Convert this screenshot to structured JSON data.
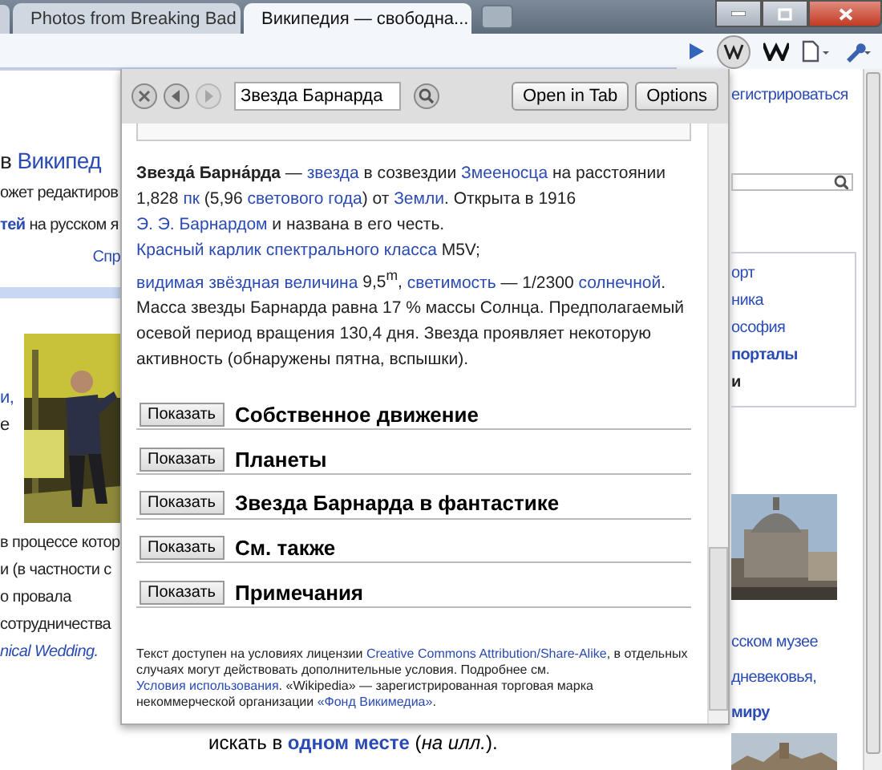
{
  "browser": {
    "tabs": [
      {
        "label": "Photos from Breaking Bad",
        "selected": false
      },
      {
        "label": "Википедия — свободна...",
        "selected": true
      }
    ]
  },
  "background": {
    "left": [
      [
        {
          "text": "в ",
          "kind": "heading"
        },
        {
          "text": "Википед",
          "kind": "heading-link"
        }
      ],
      [
        {
          "text": "ожет редактиров",
          "kind": "plain"
        }
      ],
      [
        {
          "text": "тей",
          "kind": "bold-link"
        },
        {
          "text": " на русском я",
          "kind": "plain"
        }
      ],
      [
        {
          "text": "Спр",
          "kind": "link"
        }
      ],
      [
        {
          "text": "и,",
          "kind": "link"
        }
      ],
      [
        {
          "text": "е",
          "kind": "plain"
        }
      ],
      [
        {
          "text": "в процессе котор",
          "kind": "plain"
        }
      ],
      [
        {
          "text": "и (в частности с",
          "kind": "plain"
        }
      ],
      [
        {
          "text": "о провала",
          "kind": "plain"
        }
      ],
      [
        {
          "text": "сотрудничества",
          "kind": "plain"
        }
      ],
      [
        {
          "text": "nical Wedding.",
          "kind": "italic-link"
        }
      ]
    ],
    "right": [
      [
        {
          "text": "егистрироваться",
          "kind": "link"
        }
      ],
      [
        {
          "text": "орт",
          "kind": "link"
        }
      ],
      [
        {
          "text": "ника",
          "kind": "link"
        }
      ],
      [
        {
          "text": "ософия",
          "kind": "link"
        }
      ],
      [
        {
          "text": "порталы",
          "kind": "bold-link"
        }
      ],
      [
        {
          "text": "и",
          "kind": "bold"
        }
      ],
      [
        {
          "text": "сском музее",
          "kind": "link"
        }
      ],
      [
        {
          "text": "дневековья,",
          "kind": "link"
        }
      ],
      [
        {
          "text": "миру",
          "kind": "bold-link"
        }
      ]
    ],
    "bottom_line": [
      {
        "text": "искать в ",
        "kind": "plain"
      },
      {
        "text": "одном месте",
        "kind": "bold-link"
      },
      {
        "text": " (",
        "kind": "plain"
      },
      {
        "text": "на илл.",
        "kind": "italic"
      },
      {
        "text": ").",
        "kind": "plain"
      }
    ]
  },
  "popup": {
    "nav": [
      {
        "kind": "close",
        "disabled": false
      },
      {
        "kind": "back",
        "disabled": false
      },
      {
        "kind": "forward",
        "disabled": true
      }
    ],
    "search": {
      "value": "Звезда Барнарда"
    },
    "buttons": [
      "Open in Tab",
      "Options"
    ],
    "paragraph": [
      {
        "text": "Звезда́ Барна́рда",
        "kind": "bold"
      },
      {
        "text": " — ",
        "kind": "plain"
      },
      {
        "text": "звезда",
        "kind": "link"
      },
      {
        "text": " в созвездии ",
        "kind": "plain"
      },
      {
        "text": "Змееносца",
        "kind": "link"
      },
      {
        "text": " на расстоянии 1,828 ",
        "kind": "plain"
      },
      {
        "text": "пк",
        "kind": "link"
      },
      {
        "text": " (5,96 ",
        "kind": "plain"
      },
      {
        "text": "светового года",
        "kind": "link"
      },
      {
        "text": ") от ",
        "kind": "plain"
      },
      {
        "text": "Земли",
        "kind": "link"
      },
      {
        "text": ". Открыта в 1916 ",
        "kind": "plain"
      },
      {
        "text": "Э. Э. Барнардом",
        "kind": "link"
      },
      {
        "text": " и названа в его честь. ",
        "kind": "plain"
      },
      {
        "text": "Красный карлик спектрального класса",
        "kind": "link"
      },
      {
        "text": " M5V; ",
        "kind": "plain"
      },
      {
        "text": "видимая звёздная величина",
        "kind": "link"
      },
      {
        "text": " 9,5$^{m}$, ",
        "kind": "plain"
      },
      {
        "text": "светимость",
        "kind": "link"
      },
      {
        "text": " — 1/2300 ",
        "kind": "plain"
      },
      {
        "text": "солнечной",
        "kind": "link"
      },
      {
        "text": ". Масса звезды Барнарда равна 17 % массы Солнца. Предполагаемый осевой период вращения 130,4 дня. Звезда проявляет некоторую активность (обнаружены пятна, вспышки).",
        "kind": "plain"
      }
    ],
    "sections": [
      {
        "button": "Показать",
        "title": "Собственное движение"
      },
      {
        "button": "Показать",
        "title": "Планеты"
      },
      {
        "button": "Показать",
        "title": "Звезда Барнарда в фантастике"
      },
      {
        "button": "Показать",
        "title": "См. также"
      },
      {
        "button": "Показать",
        "title": "Примечания"
      }
    ],
    "footer": [
      {
        "text": "Текст доступен на условиях лицензии ",
        "kind": "plain"
      },
      {
        "text": "Creative Commons Attribution/Share-Alike",
        "kind": "link"
      },
      {
        "text": ", в отдельных случаях могут действовать дополнительные условия. Подробнее см. ",
        "kind": "plain"
      },
      {
        "text": "Условия использования",
        "kind": "link"
      },
      {
        "text": ". «Wikipedia» — зарегистрированная торговая марка некоммерческой организации ",
        "kind": "plain"
      },
      {
        "text": "«Фонд Викимедиа»",
        "kind": "link"
      },
      {
        "text": ".",
        "kind": "plain"
      }
    ]
  }
}
